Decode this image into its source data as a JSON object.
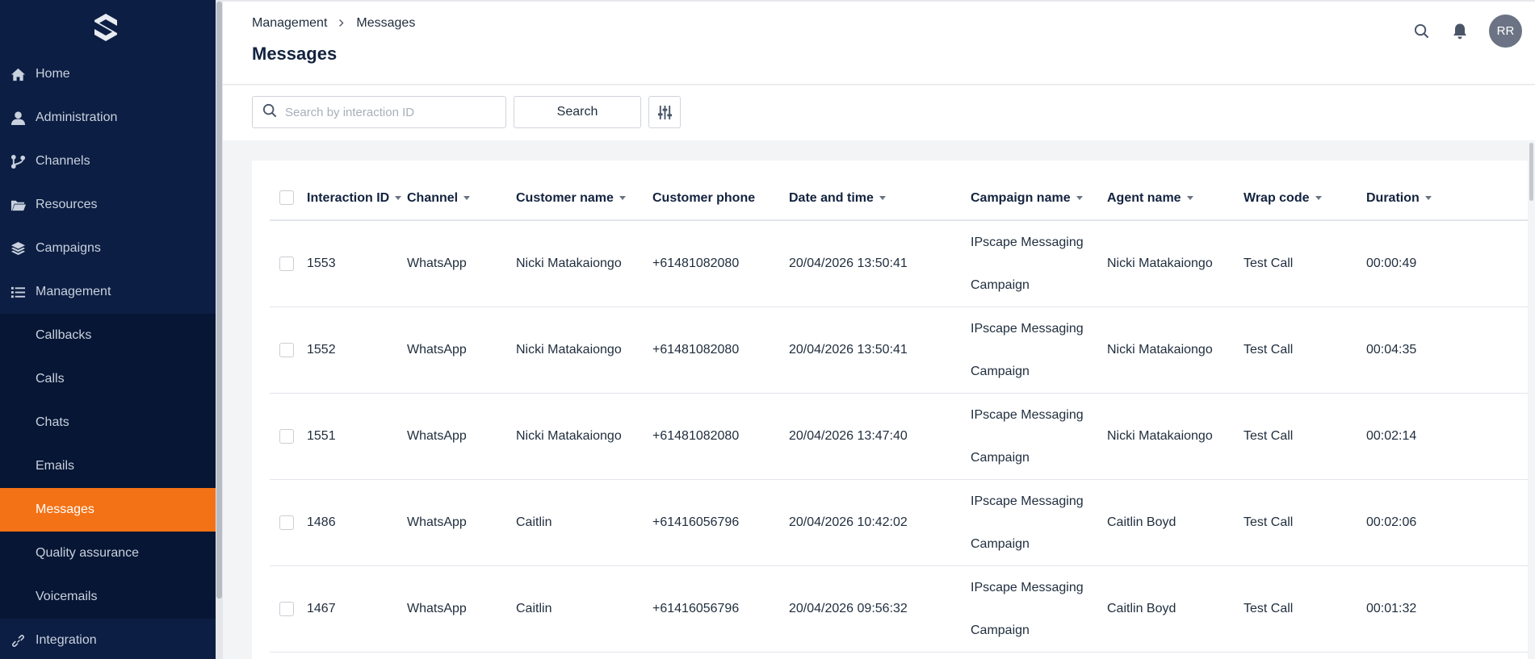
{
  "sidebar": {
    "items": [
      {
        "label": "Home",
        "icon": "home-icon"
      },
      {
        "label": "Administration",
        "icon": "user-icon"
      },
      {
        "label": "Channels",
        "icon": "branch-icon"
      },
      {
        "label": "Resources",
        "icon": "folder-icon"
      },
      {
        "label": "Campaigns",
        "icon": "layers-icon"
      },
      {
        "label": "Management",
        "icon": "list-icon"
      }
    ],
    "submenu": [
      {
        "label": "Callbacks"
      },
      {
        "label": "Calls"
      },
      {
        "label": "Chats"
      },
      {
        "label": "Emails"
      },
      {
        "label": "Messages",
        "active": true
      },
      {
        "label": "Quality assurance"
      },
      {
        "label": "Voicemails"
      }
    ],
    "bottom_item": {
      "label": "Integration",
      "icon": "link-icon"
    }
  },
  "header": {
    "breadcrumb": [
      "Management",
      "Messages"
    ],
    "title": "Messages",
    "avatar_initials": "RR"
  },
  "toolbar": {
    "search_placeholder": "Search by interaction ID",
    "search_label": "Search"
  },
  "table": {
    "columns": [
      "Interaction ID",
      "Channel",
      "Customer name",
      "Customer phone",
      "Date and time",
      "Campaign name",
      "Agent name",
      "Wrap code",
      "Duration"
    ],
    "rows": [
      {
        "id": "1553",
        "channel": "WhatsApp",
        "customer": "Nicki Matakaiongo",
        "phone": "+61481082080",
        "datetime": "20/04/2026 13:50:41",
        "campaign_1": "IPscape Messaging",
        "campaign_2": "Campaign",
        "agent": "Nicki Matakaiongo",
        "wrap": "Test Call",
        "duration": "00:00:49"
      },
      {
        "id": "1552",
        "channel": "WhatsApp",
        "customer": "Nicki Matakaiongo",
        "phone": "+61481082080",
        "datetime": "20/04/2026 13:50:41",
        "campaign_1": "IPscape Messaging",
        "campaign_2": "Campaign",
        "agent": "Nicki Matakaiongo",
        "wrap": "Test Call",
        "duration": "00:04:35"
      },
      {
        "id": "1551",
        "channel": "WhatsApp",
        "customer": "Nicki Matakaiongo",
        "phone": "+61481082080",
        "datetime": "20/04/2026 13:47:40",
        "campaign_1": "IPscape Messaging",
        "campaign_2": "Campaign",
        "agent": "Nicki Matakaiongo",
        "wrap": "Test Call",
        "duration": "00:02:14"
      },
      {
        "id": "1486",
        "channel": "WhatsApp",
        "customer": "Caitlin",
        "phone": "+61416056796",
        "datetime": "20/04/2026 10:42:02",
        "campaign_1": "IPscape Messaging",
        "campaign_2": "Campaign",
        "agent": "Caitlin Boyd",
        "wrap": "Test Call",
        "duration": "00:02:06"
      },
      {
        "id": "1467",
        "channel": "WhatsApp",
        "customer": "Caitlin",
        "phone": "+61416056796",
        "datetime": "20/04/2026 09:56:32",
        "campaign_1": "IPscape Messaging",
        "campaign_2": "Campaign",
        "agent": "Caitlin Boyd",
        "wrap": "Test Call",
        "duration": "00:01:32"
      }
    ]
  },
  "colors": {
    "sidebar_bg": "#0c1e43",
    "submenu_bg": "#071634",
    "accent": "#f47216"
  }
}
